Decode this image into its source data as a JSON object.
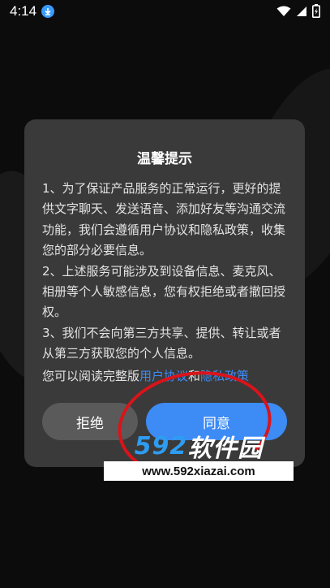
{
  "status_bar": {
    "time": "4:14",
    "icons": [
      "download-icon",
      "wifi-icon",
      "signal-icon",
      "battery-icon"
    ]
  },
  "dialog": {
    "title": "温馨提示",
    "paragraphs": [
      "1、为了保证产品服务的正常运行，更好的提供文字聊天、发送语音、添加好友等沟通交流功能，我们会遵循用户协议和隐私政策，收集您的部分必要信息。",
      "2、上述服务可能涉及到设备信息、麦克风、相册等个人敏感信息，您有权拒绝或者撤回授权。",
      "3、我们不会向第三方共享、提供、转让或者从第三方获取您的个人信息。"
    ],
    "read_prefix": "您可以阅读完整版",
    "user_agreement_link": "用户协议",
    "and_text": "和",
    "privacy_link": "隐私政策",
    "reject_label": "拒绝",
    "agree_label": "同意"
  },
  "watermark": {
    "number": "592",
    "name": "软件园",
    "url": "www.592xiazai.com"
  },
  "colors": {
    "accent": "#3d8bf5",
    "dialog_bg": "#3a3a3a",
    "reject_bg": "#5a5a5a",
    "annotation_red": "#d9141b"
  }
}
